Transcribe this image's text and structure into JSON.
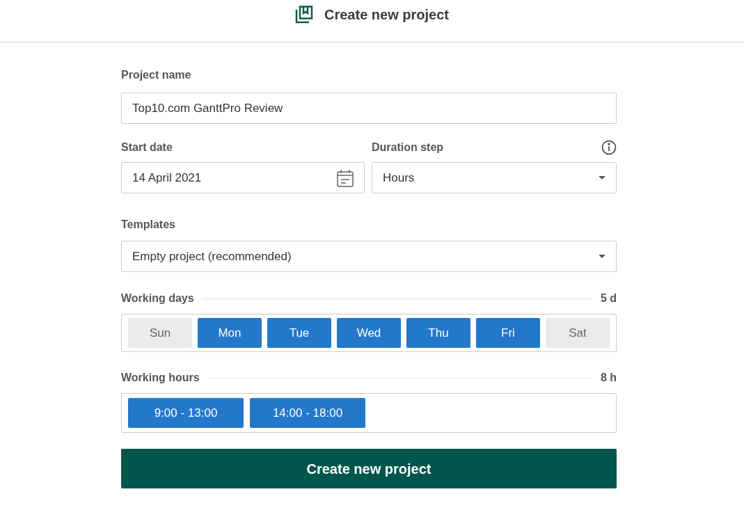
{
  "header": {
    "title": "Create new project"
  },
  "project_name": {
    "label": "Project name",
    "value": "Top10.com GanttPro Review"
  },
  "start_date": {
    "label": "Start date",
    "value": "14 April 2021"
  },
  "duration_step": {
    "label": "Duration step",
    "value": "Hours"
  },
  "templates": {
    "label": "Templates",
    "value": "Empty project (recommended)"
  },
  "working_days": {
    "label": "Working days",
    "total": "5 d",
    "days": [
      {
        "label": "Sun",
        "selected": false
      },
      {
        "label": "Mon",
        "selected": true
      },
      {
        "label": "Tue",
        "selected": true
      },
      {
        "label": "Wed",
        "selected": true
      },
      {
        "label": "Thu",
        "selected": true
      },
      {
        "label": "Fri",
        "selected": true
      },
      {
        "label": "Sat",
        "selected": false
      }
    ]
  },
  "working_hours": {
    "label": "Working hours",
    "total": "8 h",
    "ranges": [
      "9:00 - 13:00",
      "14:00 - 18:00"
    ]
  },
  "submit": "Create new project"
}
